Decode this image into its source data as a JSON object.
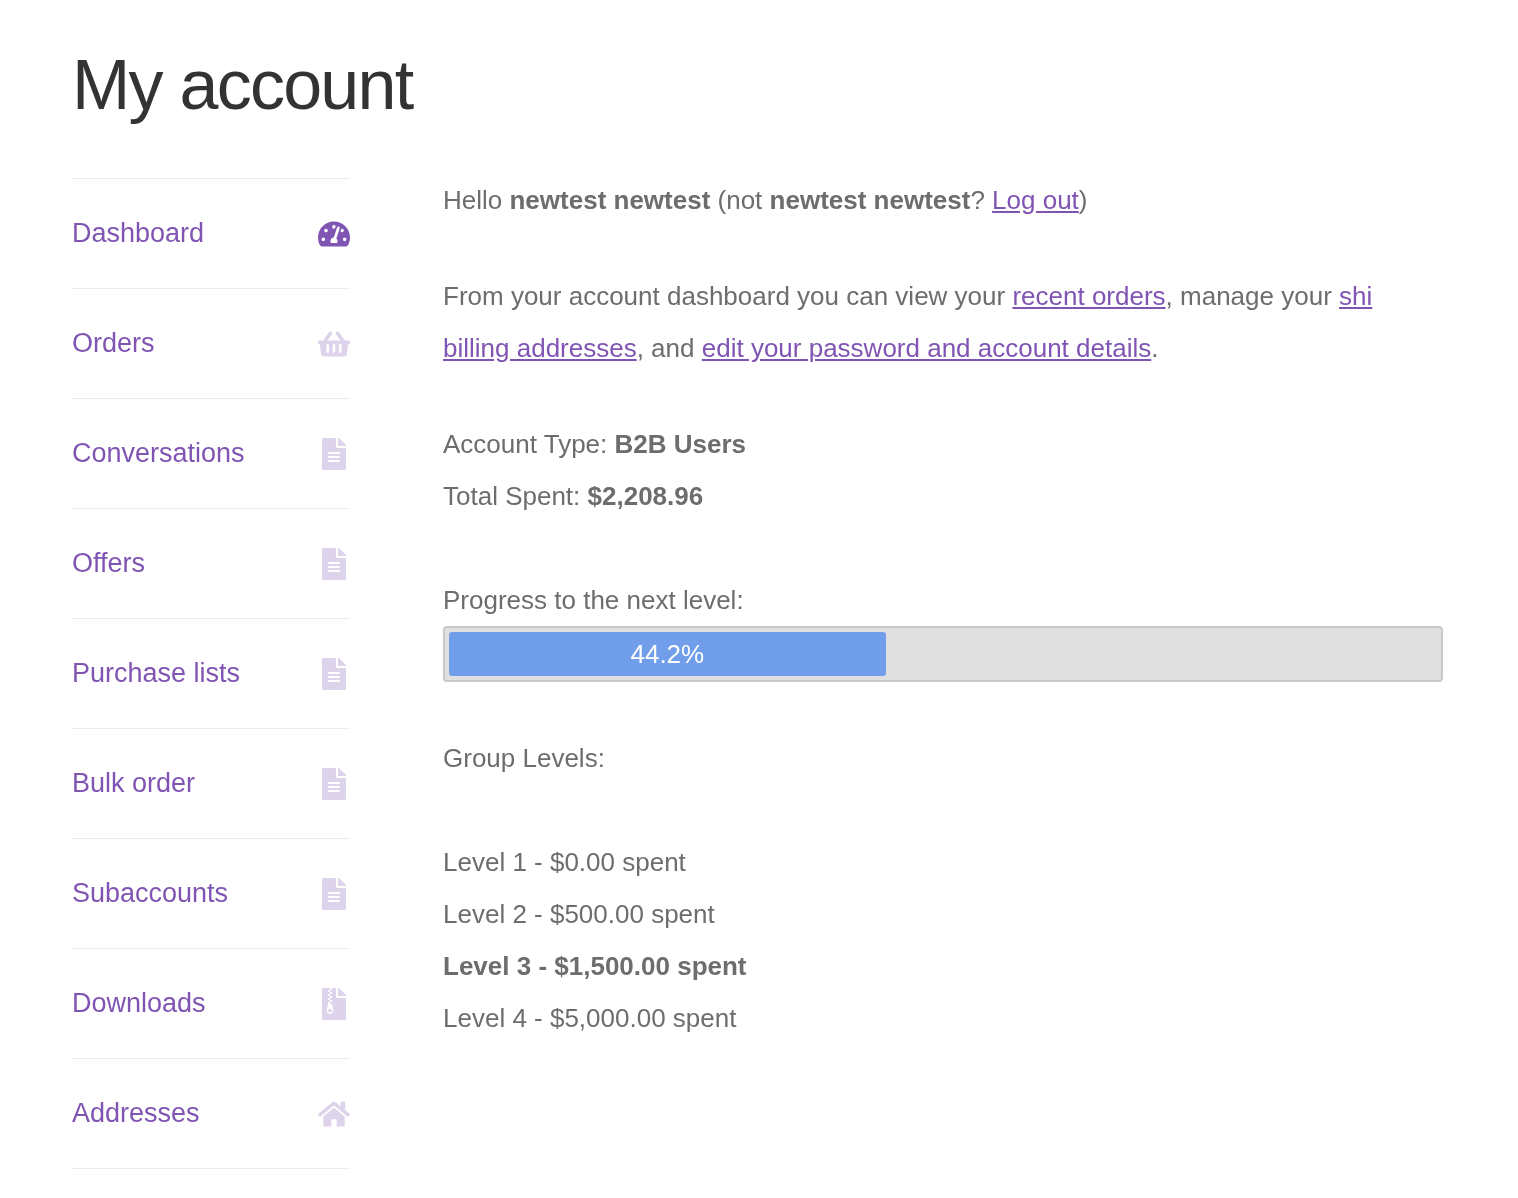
{
  "page_title": "My account",
  "nav": [
    {
      "label": "Dashboard",
      "kind": "dashboard",
      "selected": true
    },
    {
      "label": "Orders",
      "kind": "orders",
      "selected": false
    },
    {
      "label": "Conversations",
      "kind": "page",
      "selected": false
    },
    {
      "label": "Offers",
      "kind": "page",
      "selected": false
    },
    {
      "label": "Purchase lists",
      "kind": "page",
      "selected": false
    },
    {
      "label": "Bulk order",
      "kind": "page",
      "selected": false
    },
    {
      "label": "Subaccounts",
      "kind": "page",
      "selected": false
    },
    {
      "label": "Downloads",
      "kind": "downloads",
      "selected": false
    },
    {
      "label": "Addresses",
      "kind": "addresses",
      "selected": false
    }
  ],
  "greeting": {
    "before": "Hello **newtest newtest** (not **newtest newtest**? ",
    "link": "Log out",
    "after": ")"
  },
  "intro": [
    [
      {
        "kind": "text",
        "text": "From your account dashboard you can view your "
      },
      {
        "kind": "link",
        "text": "recent orders"
      },
      {
        "kind": "text",
        "text": ", manage your "
      },
      {
        "kind": "link",
        "text": "shi"
      }
    ],
    [
      {
        "kind": "link",
        "text": "billing addresses"
      },
      {
        "kind": "text",
        "text": ", and "
      },
      {
        "kind": "link",
        "text": "edit your password and account details"
      },
      {
        "kind": "text",
        "text": "."
      }
    ]
  ],
  "account_type": "Account Type: **B2B Users**",
  "total_spent": "Total Spent: **$2,208.96**",
  "progress": {
    "label": "Progress to the next level:",
    "level": 0.442,
    "reading": "44.2%"
  },
  "group_levels": {
    "heading": "Group Levels:",
    "levels": [
      {
        "text": "Level 1 - $0.00 spent",
        "current": false
      },
      {
        "text": "Level 2 - $500.00 spent",
        "current": false
      },
      {
        "text": "Level 3 - $1,500.00 spent",
        "current": true
      },
      {
        "text": "Level 4 - $5,000.00 spent",
        "current": false
      }
    ]
  }
}
